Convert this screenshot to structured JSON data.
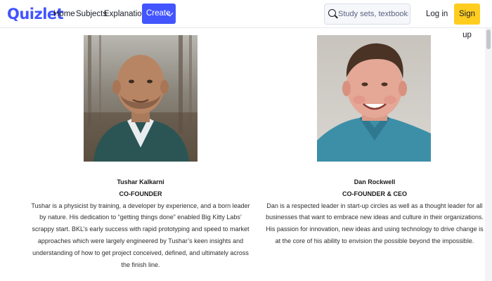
{
  "header": {
    "logo": "Quizlet",
    "nav": {
      "home": "Home",
      "subjects": "Subjects",
      "explanations": "Explanations"
    },
    "create_label": "Create",
    "search": {
      "placeholder": "Study sets, textbooks, ..."
    },
    "login_label": "Log in",
    "signup_label": "Sign up"
  },
  "colors": {
    "brand": "#4255ff",
    "signup": "#ffcd1f"
  },
  "people": [
    {
      "name": "Tushar Kalkarni",
      "role": "CO-FOUNDER",
      "bio": "Tushar is a physicist by training, a developer by experience, and a born leader by nature. His dedication to “getting things done” enabled Big Kitty Labs’ scrappy start. BKL’s early success with rapid prototyping and speed to market approaches which were largely engineered by Tushar’s keen insights and understanding of how to get project conceived, defined, and ultimately across the finish line."
    },
    {
      "name": "Dan Rockwell",
      "role": "CO-FOUNDER & CEO",
      "bio": "Dan is a respected leader in start-up circles as well as a thought leader for all businesses that want to embrace new ideas and culture in their organizations. His passion for innovation, new ideas and using technology to drive change is at the core of his ability to envision the possible beyond the impossible."
    }
  ]
}
